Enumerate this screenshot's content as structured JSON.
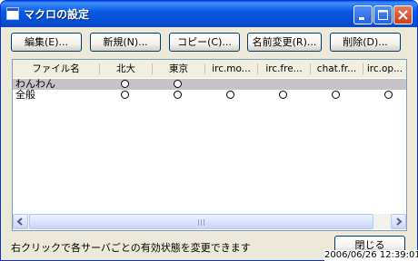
{
  "window": {
    "title": "マクロの設定"
  },
  "title_buttons": {
    "minimize": "minimize-icon",
    "maximize": "maximize-icon",
    "close": "close-icon"
  },
  "toolbar": {
    "edit": "編集(E)...",
    "new": "新規(N)...",
    "copy": "コピー(C)...",
    "rename": "名前変更(R)...",
    "delete": "削除(D)..."
  },
  "list": {
    "columns": [
      "ファイル名",
      "北大",
      "東京",
      "irc.mo...",
      "irc.fre...",
      "chat.fr...",
      "irc.op..."
    ],
    "rows": [
      {
        "name": "わんわん",
        "enabled": [
          true,
          true,
          false,
          false,
          false,
          false
        ],
        "selected": true
      },
      {
        "name": "全般",
        "enabled": [
          true,
          true,
          true,
          true,
          true,
          true
        ],
        "selected": false
      }
    ]
  },
  "status": {
    "text": "右クリックで各サーバごとの有効状態を変更できます"
  },
  "close_button": {
    "label": "閉じる"
  },
  "timestamp": "2006/06/26 12:39:01"
}
